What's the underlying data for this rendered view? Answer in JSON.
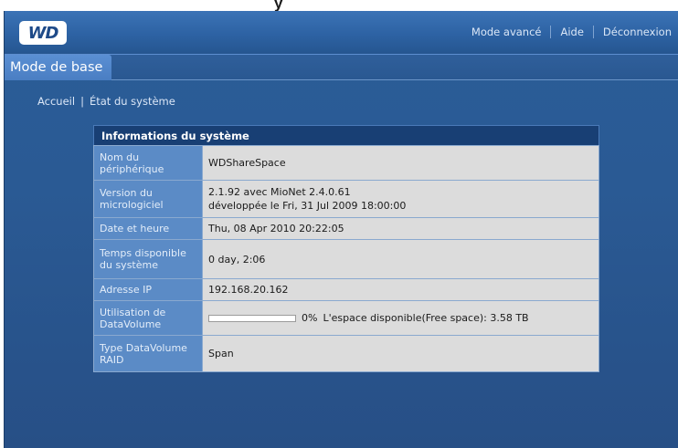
{
  "page_title_fragment": "y",
  "header": {
    "logo_text": "WD",
    "nav": [
      {
        "label": "Mode avancé"
      },
      {
        "label": "Aide"
      },
      {
        "label": "Déconnexion"
      }
    ]
  },
  "tabs": [
    {
      "label": "Mode de base",
      "active": true
    }
  ],
  "breadcrumb": {
    "home": "Accueil",
    "separator": "|",
    "current": "État du système"
  },
  "system_info": {
    "title": "Informations du système",
    "rows": {
      "device_name": {
        "label": "Nom du périphérique",
        "value": "WDShareSpace"
      },
      "firmware": {
        "label": "Version du micrologiciel",
        "value_line1": "2.1.92 avec MioNet 2.4.0.61",
        "value_line2": "développée le Fri, 31 Jul 2009 18:00:00"
      },
      "datetime": {
        "label": "Date et heure",
        "value": "Thu, 08 Apr 2010 20:22:05"
      },
      "uptime": {
        "label": "Temps disponible du système",
        "value": "0 day, 2:06"
      },
      "ip": {
        "label": "Adresse IP",
        "value": "192.168.20.162"
      },
      "usage": {
        "label": "Utilisation de DataVolume",
        "percent": 0,
        "percent_text": "0%",
        "free_text": "L'espace disponible(Free space): 3.58 TB"
      },
      "raid": {
        "label": "Type DataVolume RAID",
        "value": "Span"
      }
    }
  },
  "colors": {
    "frame_blue": "#2b5d98",
    "panel_header": "#183f74",
    "label_cell": "#5b8bc6",
    "value_cell": "#dcdcdc"
  }
}
